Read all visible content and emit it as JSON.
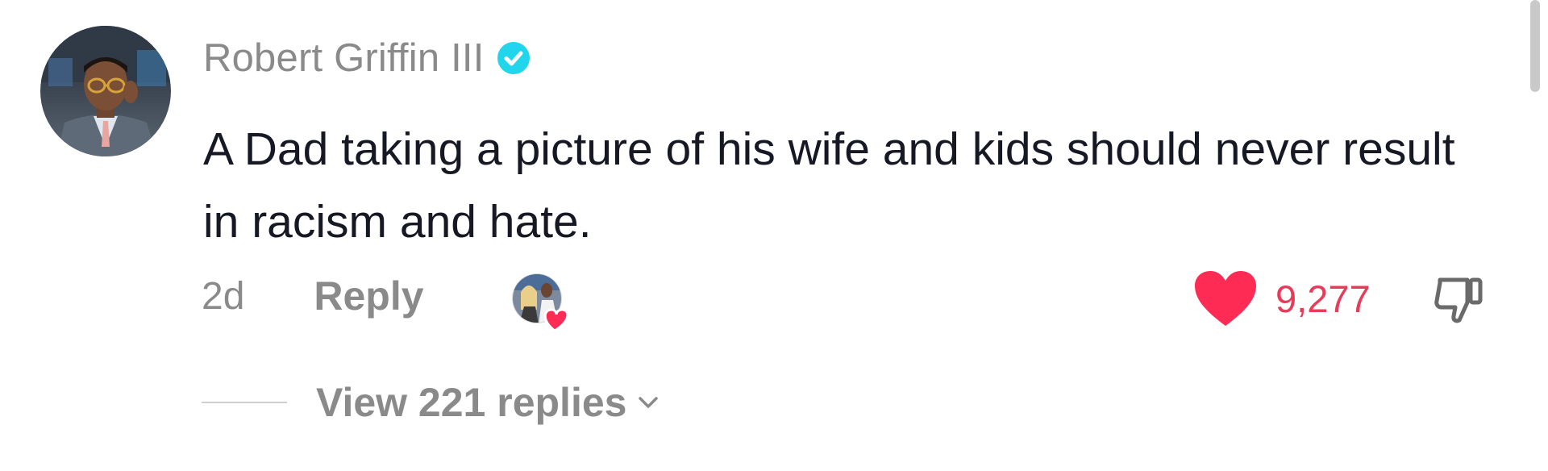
{
  "comment": {
    "author": {
      "name": "Robert Griffin III",
      "verified": true,
      "avatar_icon": "user-avatar"
    },
    "text": "A Dad taking a picture of his wife and kids should never result in racism and hate.",
    "time": "2d",
    "reply_label": "Reply",
    "creator_liked_icon": "creator-liked-heart",
    "likes": {
      "count": "9,277",
      "liked": true,
      "color": "#fe2c55"
    },
    "dislike_icon": "thumbs-down-icon",
    "view_replies_label": "View 221 replies"
  },
  "colors": {
    "author": "#8a8a8a",
    "text": "#161823",
    "verified": "#20d5ec",
    "like": "#fe2c55"
  }
}
